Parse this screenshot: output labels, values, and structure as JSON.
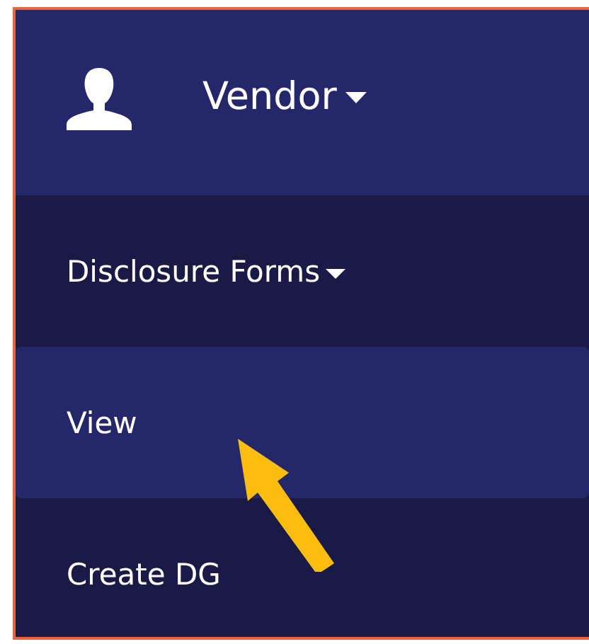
{
  "header": {
    "label": "Vendor",
    "caret": true
  },
  "menu": [
    {
      "label": "Disclosure Forms",
      "caret": true,
      "selected": false
    },
    {
      "label": "View",
      "caret": false,
      "selected": true
    },
    {
      "label": "Create DG",
      "caret": false,
      "selected": false
    }
  ]
}
